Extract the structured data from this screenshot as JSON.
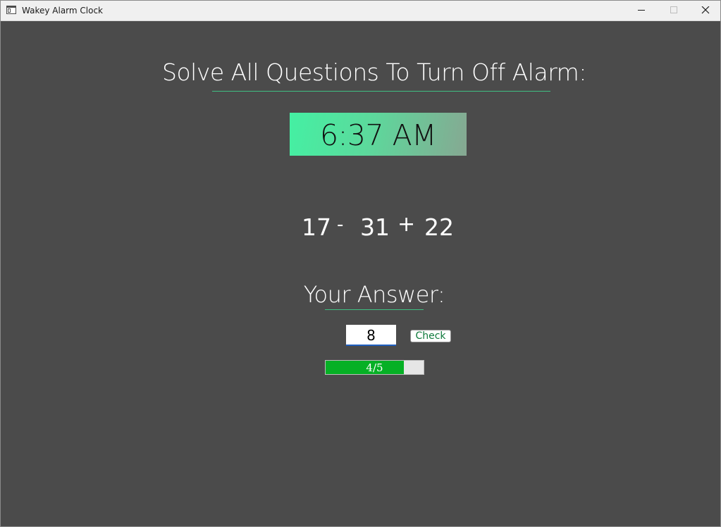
{
  "window": {
    "title": "Wakey Alarm Clock",
    "icon": "app-window-icon",
    "controls": {
      "minimize_icon": "minimize-icon",
      "maximize_icon": "maximize-icon",
      "close_icon": "close-icon"
    }
  },
  "main": {
    "heading": "Solve All Questions To Turn Off Alarm:",
    "clock": {
      "time": "6:37 AM",
      "gradient_colors": [
        "#44f0a3",
        "#86a892"
      ]
    },
    "question": {
      "operand1": "17",
      "operator1": "-",
      "operand2": "31",
      "operator2": "+",
      "operand3": "22"
    },
    "answer_label": "Your Answer:",
    "answer_input": {
      "value": "8"
    },
    "check_button_label": "Check",
    "progress": {
      "label": "4/5",
      "completed": 4,
      "total": 5,
      "fill_color": "#06b025"
    }
  },
  "colors": {
    "background": "#4b4b4b",
    "accent": "#3fbf83",
    "button_text": "#0f7a3c"
  }
}
